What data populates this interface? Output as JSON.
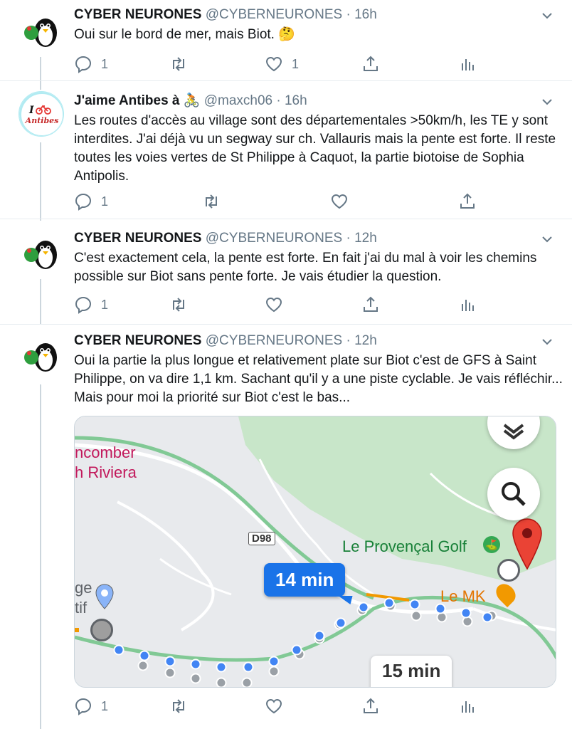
{
  "tweets": [
    {
      "name": "CYBER NEURONES",
      "handle": "@CYBERNEURONES",
      "time": "16h",
      "text": "Oui sur le bord de mer, mais Biot. 🤔",
      "reply_count": "1",
      "retweet_count": "",
      "like_count": "1"
    },
    {
      "name": "J'aime Antibes à 🚴",
      "handle": "@maxch06",
      "time": "16h",
      "text": "Les routes d'accès au village sont des départementales >50km/h, les TE y sont interdites. J'ai déjà vu un segway sur ch. Vallauris mais la pente est forte. Il reste toutes les voies vertes de St Philippe à Caquot, la partie biotoise de Sophia Antipolis.",
      "reply_count": "1",
      "retweet_count": "",
      "like_count": ""
    },
    {
      "name": "CYBER NEURONES",
      "handle": "@CYBERNEURONES",
      "time": "12h",
      "text": "C'est exactement cela, la pente est forte. En fait j'ai du mal à voir les chemins possible sur Biot sans pente forte. Je vais étudier la question.",
      "reply_count": "1",
      "retweet_count": "",
      "like_count": ""
    },
    {
      "name": "CYBER NEURONES",
      "handle": "@CYBERNEURONES",
      "time": "12h",
      "text": "Oui la partie la plus longue et relativement plate sur Biot c'est de GFS à Saint Philippe, on va dire 1,1 km. Sachant qu'il y a une piste cyclable. Je vais réfléchir... Mais pour moi la priorité sur Biot c'est le bas...",
      "reply_count": "1",
      "retweet_count": "",
      "like_count": ""
    }
  ],
  "avatar_logo_text": "I ❤ Antibes",
  "separator": "·",
  "map": {
    "label_combe": "ncomber",
    "label_riviera": "h Riviera",
    "label_road": "D98",
    "label_golf": "Le Provençal Golf",
    "label_mk": "Le MK",
    "label_left1": "ge",
    "label_left2": "tif",
    "route_time_main": "14 min",
    "route_time_alt": "15 min",
    "icons": [
      "layers-icon",
      "search-icon",
      "red-pin-icon",
      "golf-icon",
      "restaurant-icon",
      "place-pin-icon"
    ],
    "colors": {
      "route": "#4285f4",
      "alt_route": "#9aa0a6",
      "park": "#c8e6c9",
      "pin": "#ea4335",
      "label_pink": "#c2185b",
      "label_green": "#188038",
      "label_orange": "#e37400"
    }
  },
  "colors": {
    "text": "#14171a",
    "muted": "#657786",
    "divider": "#e6ecf0"
  }
}
